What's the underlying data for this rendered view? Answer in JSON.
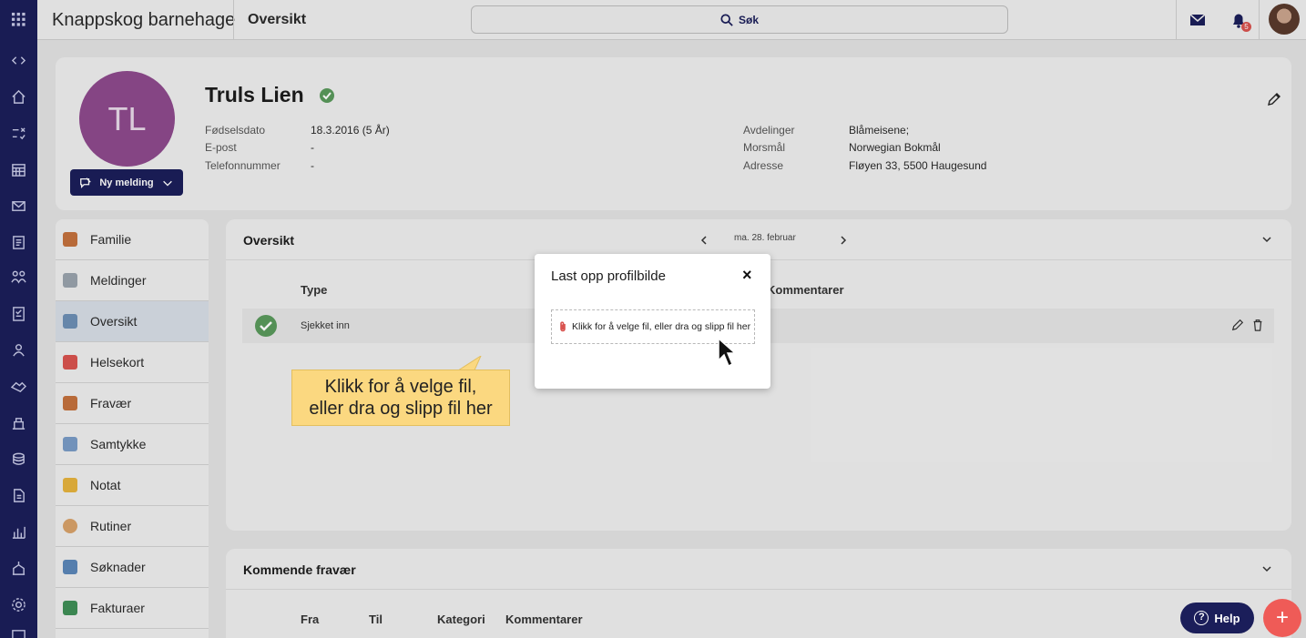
{
  "app": {
    "title": "Knappskog barnehage",
    "page_title": "Oversikt"
  },
  "search": {
    "label": "Søk"
  },
  "notifications": {
    "count": "5"
  },
  "rail_icons": [
    "collapse-icon",
    "home-icon",
    "tasks-icon",
    "calendar-icon",
    "mail-icon",
    "news-icon",
    "groups-icon",
    "checklist-icon",
    "people-icon",
    "handshake-icon",
    "building-icon",
    "finance-icon",
    "document-icon",
    "chart-icon",
    "school-icon",
    "settings-icon",
    "list-icon"
  ],
  "profile": {
    "initials": "TL",
    "name": "Truls Lien",
    "new_message_label": "Ny melding",
    "left_fields": [
      {
        "label": "Fødselsdato",
        "value": "18.3.2016 (5 År)"
      },
      {
        "label": "E-post",
        "value": "-"
      },
      {
        "label": "Telefonnummer",
        "value": "-"
      }
    ],
    "right_fields": [
      {
        "label": "Avdelinger",
        "value": "Blåmeisene;"
      },
      {
        "label": "Morsmål",
        "value": "Norwegian Bokmål"
      },
      {
        "label": "Adresse",
        "value": "Fløyen 33, 5500 Haugesund"
      }
    ]
  },
  "nav": {
    "items": [
      {
        "label": "Familie",
        "color": "#c4713d"
      },
      {
        "label": "Meldinger",
        "color": "#9aa3ad"
      },
      {
        "label": "Oversikt",
        "color": "#6d8fb5"
      },
      {
        "label": "Helsekort",
        "color": "#d9534f"
      },
      {
        "label": "Fravær",
        "color": "#c4713d"
      },
      {
        "label": "Samtykke",
        "color": "#7a9cc6"
      },
      {
        "label": "Notat",
        "color": "#e6b33d"
      },
      {
        "label": "Rutiner",
        "color": "#d8a26a"
      },
      {
        "label": "Søknader",
        "color": "#5b86b8"
      },
      {
        "label": "Fakturaer",
        "color": "#3f8f57"
      }
    ]
  },
  "overview": {
    "title": "Oversikt",
    "date": "ma. 28. februar",
    "columns": {
      "type": "Type",
      "comments": "Kommentarer"
    },
    "rows": [
      {
        "type": "Sjekket inn"
      }
    ]
  },
  "upcoming": {
    "title": "Kommende fravær",
    "columns": [
      "Fra",
      "Til",
      "Kategori",
      "Kommentarer"
    ]
  },
  "modal": {
    "title": "Last opp profilbilde",
    "close": "×",
    "dropzone_text": "Klikk for å velge fil, eller dra og slipp fil her"
  },
  "callout": {
    "line1": "Klikk for å velge fil,",
    "line2": "eller dra og slipp fil her"
  },
  "help": {
    "label": "Help"
  },
  "fab": {
    "label": "+"
  }
}
